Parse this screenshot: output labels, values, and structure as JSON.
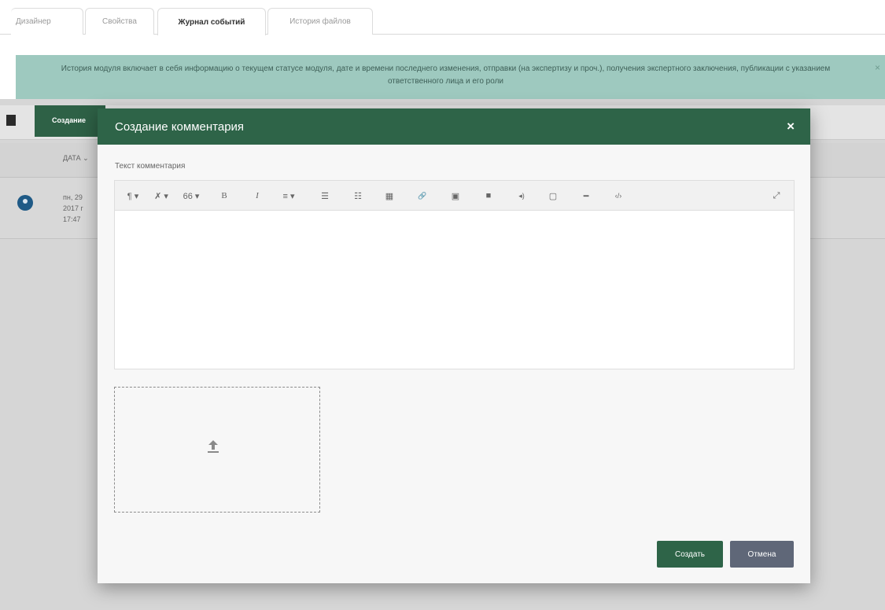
{
  "tabs": [
    {
      "label": "Дизайнер"
    },
    {
      "label": "Свойства"
    },
    {
      "label": "Журнал событий"
    },
    {
      "label": "История файлов"
    }
  ],
  "alert": {
    "text": "История модуля включает в себя информацию о текущем статусе модуля, дате и времени последнего изменения, отправки (на экспертизу и проч.), получения экспертного заключения, публикации с указанием ответственного лица и его роли",
    "close": "×"
  },
  "background": {
    "tab_label": "Создание",
    "date_header": "ДАТА ⌄",
    "row_text": "пн, 29\n2017 г\n17:47"
  },
  "modal": {
    "title": "Создание комментария",
    "close": "×",
    "field_label": "Текст комментария",
    "toolbar": [
      {
        "name": "paragraph-format-icon",
        "glyph": "¶ ▾"
      },
      {
        "name": "text-color-icon",
        "glyph": "✗ ▾"
      },
      {
        "name": "quote-icon",
        "glyph": "66 ▾"
      },
      {
        "name": "bold-icon",
        "glyph": "B"
      },
      {
        "name": "italic-icon",
        "glyph": "I"
      },
      {
        "name": "align-icon",
        "glyph": "≡ ▾"
      },
      {
        "name": "ordered-list-icon",
        "glyph": "☰"
      },
      {
        "name": "unordered-list-icon",
        "glyph": "☷"
      },
      {
        "name": "table-icon",
        "glyph": "▦"
      },
      {
        "name": "link-icon",
        "glyph": "🔗"
      },
      {
        "name": "image-icon",
        "glyph": "▣"
      },
      {
        "name": "video-icon",
        "glyph": "■"
      },
      {
        "name": "audio-icon",
        "glyph": "◂)"
      },
      {
        "name": "file-icon",
        "glyph": "▢"
      },
      {
        "name": "horizontal-line-icon",
        "glyph": "━"
      },
      {
        "name": "code-view-icon",
        "glyph": "‹/›"
      },
      {
        "name": "fullscreen-icon",
        "glyph": "⤢"
      }
    ],
    "editor_value": "",
    "buttons": {
      "create": "Создать",
      "cancel": "Отмена"
    }
  },
  "colors": {
    "header_green": "#2e6448",
    "alert_bg": "#9ec9bf",
    "cancel_gray": "#5f6778"
  }
}
